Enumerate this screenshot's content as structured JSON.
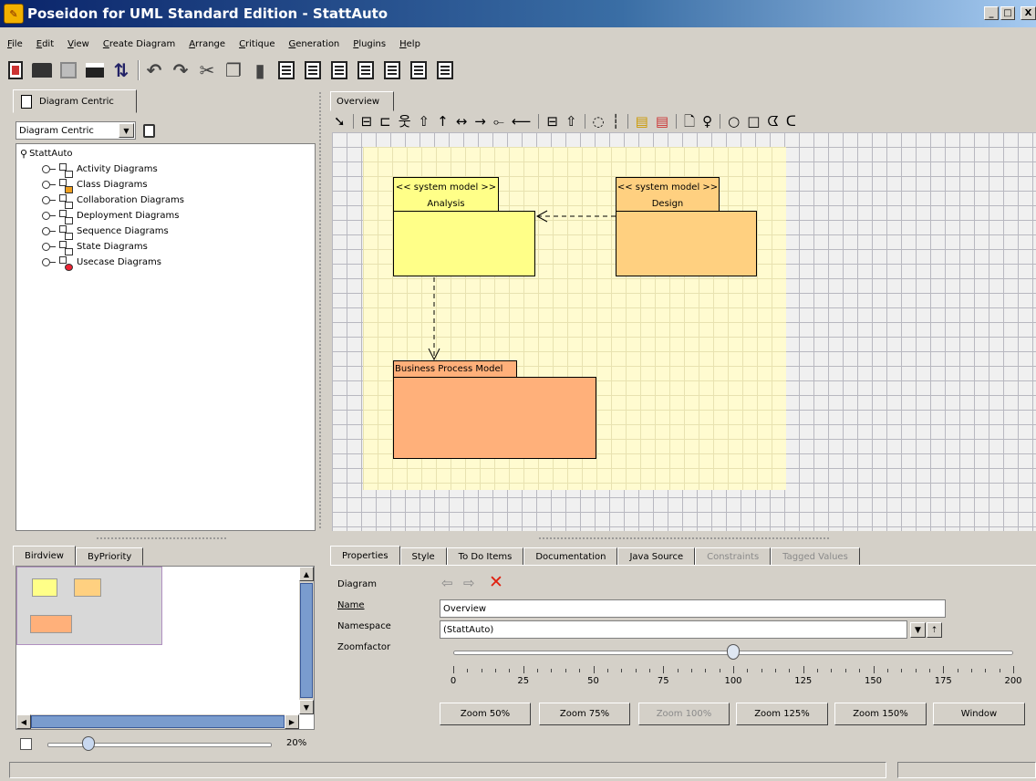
{
  "window": {
    "title": "Poseidon for UML Standard Edition - StattAuto",
    "minimize": "_",
    "maximize": "□",
    "close": "X"
  },
  "menu": [
    "File",
    "Edit",
    "View",
    "Create Diagram",
    "Arrange",
    "Critique",
    "Generation",
    "Plugins",
    "Help"
  ],
  "left_panel": {
    "tab_label": "Diagram Centric",
    "combo_value": "Diagram Centric",
    "tree_root": "StattAuto",
    "tree_items": [
      "Activity Diagrams",
      "Class Diagrams",
      "Collaboration Diagrams",
      "Deployment Diagrams",
      "Sequence Diagrams",
      "State Diagrams",
      "Usecase Diagrams"
    ]
  },
  "bottom_left": {
    "tabs": [
      "Birdview",
      "ByPriority"
    ],
    "zoom_label": "20%",
    "zoom_value": 0.2
  },
  "diagram": {
    "tab_label": "Overview",
    "packages": [
      {
        "stereotype": "<< system model >>",
        "name": "Analysis",
        "color": "#ffff88"
      },
      {
        "stereotype": "<< system model >>",
        "name": "Design",
        "color": "#ffd080"
      },
      {
        "stereotype": "",
        "name": "Business Process Model",
        "color": "#ffb07a"
      }
    ]
  },
  "properties": {
    "tabs": [
      "Properties",
      "Style",
      "To Do Items",
      "Documentation",
      "Java Source",
      "Constraints",
      "Tagged Values"
    ],
    "disabled_tabs": [
      "Constraints",
      "Tagged Values"
    ],
    "diagram_label": "Diagram",
    "name_label": "Name",
    "name_value": "Overview",
    "namespace_label": "Namespace",
    "namespace_value": "(StattAuto)",
    "zoomfactor_label": "Zoomfactor",
    "zoom_value": 100,
    "zoom_ticks": [
      "0",
      "25",
      "50",
      "75",
      "100",
      "125",
      "150",
      "175",
      "200"
    ],
    "buttons": [
      "Zoom 50%",
      "Zoom 75%",
      "Zoom 100%",
      "Zoom 125%",
      "Zoom 150%",
      "Window"
    ],
    "disabled_button": "Zoom 100%"
  },
  "colors": {
    "titlebar": "#0a246a",
    "delete_icon": "#e02010",
    "selection_thumb": "#7a9cce"
  }
}
